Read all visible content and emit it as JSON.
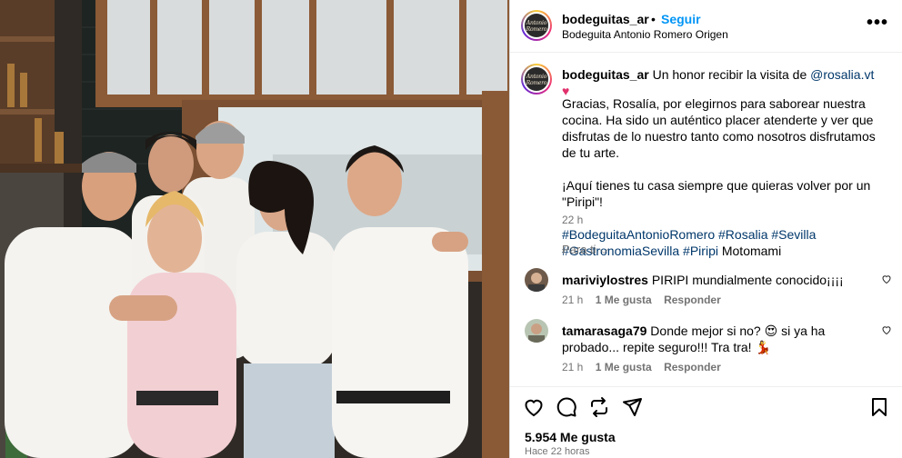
{
  "post": {
    "username": "bodeguitas_ar",
    "separator": "•",
    "follow_label": "Seguir",
    "location": "Bodeguita Antonio Romero Origen",
    "more_label": "•••",
    "avatar_text": "Antonio Romero"
  },
  "caption": {
    "username": "bodeguitas_ar",
    "intro": "Un honor recibir la visita de",
    "mention": "@rosalia.vt",
    "heart": "♥",
    "paragraph1": "Gracias, Rosalía, por elegirnos para saborear nuestra cocina. Ha sido un auténtico placer atenderte y ver que disfrutas de lo nuestro tanto como nosotros disfrutamos de tu arte.",
    "paragraph2": "¡Aquí tienes tu casa siempre que quieras volver por un \"Piripi\"!",
    "hashtags": "#BodeguitaAntonioRomero #Rosalia #Sevilla #GastronomiaSevilla #Piripi",
    "trailing": "Motomami",
    "time": "22 h"
  },
  "para_ti": "Para ti ⌵",
  "comments": [
    {
      "username": "mariviylostres",
      "text": "PIRIPI mundialmente conocido¡¡¡¡",
      "time": "21 h",
      "likes": "1 Me gusta",
      "reply": "Responder"
    },
    {
      "username": "tamarasaga79",
      "text": "Donde mejor si no? 😍 si ya ha probado... repite seguro!!! Tra tra! 💃",
      "time": "21 h",
      "likes": "1 Me gusta",
      "reply": "Responder"
    }
  ],
  "footer": {
    "likes": "5.954 Me gusta",
    "ago": "Hace 22 horas"
  },
  "icons": {
    "like": "heart-icon",
    "comment": "comment-icon",
    "share": "repost-icon",
    "send": "send-icon",
    "save": "bookmark-icon"
  },
  "colors": {
    "link": "#0095f6",
    "mention": "#00376b",
    "muted": "#737373"
  }
}
